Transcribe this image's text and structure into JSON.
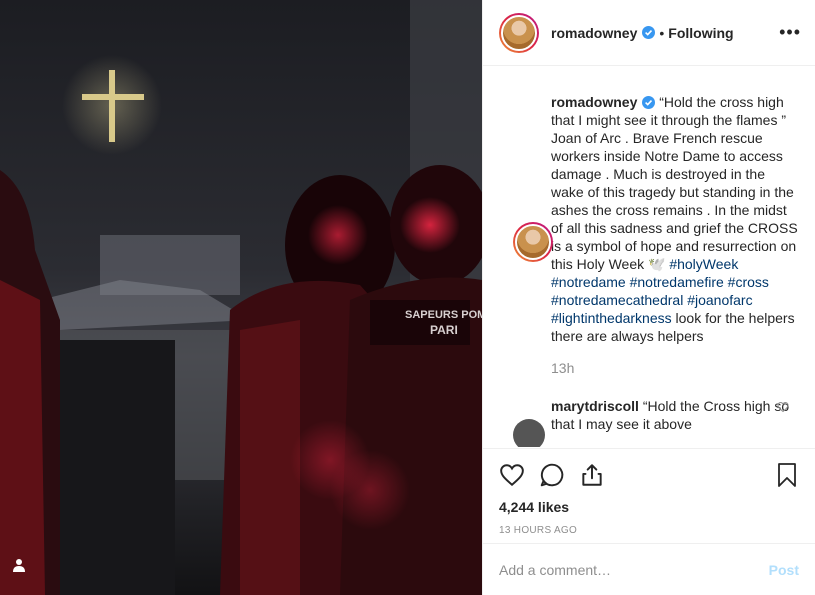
{
  "post": {
    "username": "romadowney",
    "follow_status": "Following",
    "separator": "•",
    "more_icon": "more-horizontal-icon"
  },
  "caption": {
    "author": "romadowney",
    "segments": [
      {
        "type": "text",
        "value": " “Hold the cross high that I might see it through the flames ” Joan of Arc . Brave French rescue workers inside Notre Dame to access damage . Much is destroyed in the wake of this tragedy but standing in the ashes the cross remains . In the midst of all this sadness and grief the CROSS is a symbol of hope and resurrection on this Holy Week 🕊️ "
      },
      {
        "type": "tag",
        "value": "#holyWeek"
      },
      {
        "type": "text",
        "value": " "
      },
      {
        "type": "tag",
        "value": "#notredame"
      },
      {
        "type": "text",
        "value": " "
      },
      {
        "type": "tag",
        "value": "#notredamefire"
      },
      {
        "type": "text",
        "value": " "
      },
      {
        "type": "tag",
        "value": "#cross"
      },
      {
        "type": "text",
        "value": " "
      },
      {
        "type": "tag",
        "value": "#notredamecathedral"
      },
      {
        "type": "text",
        "value": " "
      },
      {
        "type": "tag",
        "value": "#joanofarc"
      },
      {
        "type": "text",
        "value": " "
      },
      {
        "type": "tag",
        "value": "#lightinthedarkness"
      },
      {
        "type": "text",
        "value": " look for the helpers there are always helpers"
      }
    ],
    "time": "13h"
  },
  "reply": {
    "author": "marytdriscoll",
    "text": " “Hold the Cross high so that I may see it above"
  },
  "actions": {
    "likes": "4,244 likes",
    "ago": "13 HOURS AGO"
  },
  "comment_box": {
    "placeholder": "Add a comment…",
    "post_label": "Post"
  },
  "colors": {
    "hashtag": "#00376b",
    "verified": "#3897f0",
    "post_disabled": "#b2dffc"
  }
}
